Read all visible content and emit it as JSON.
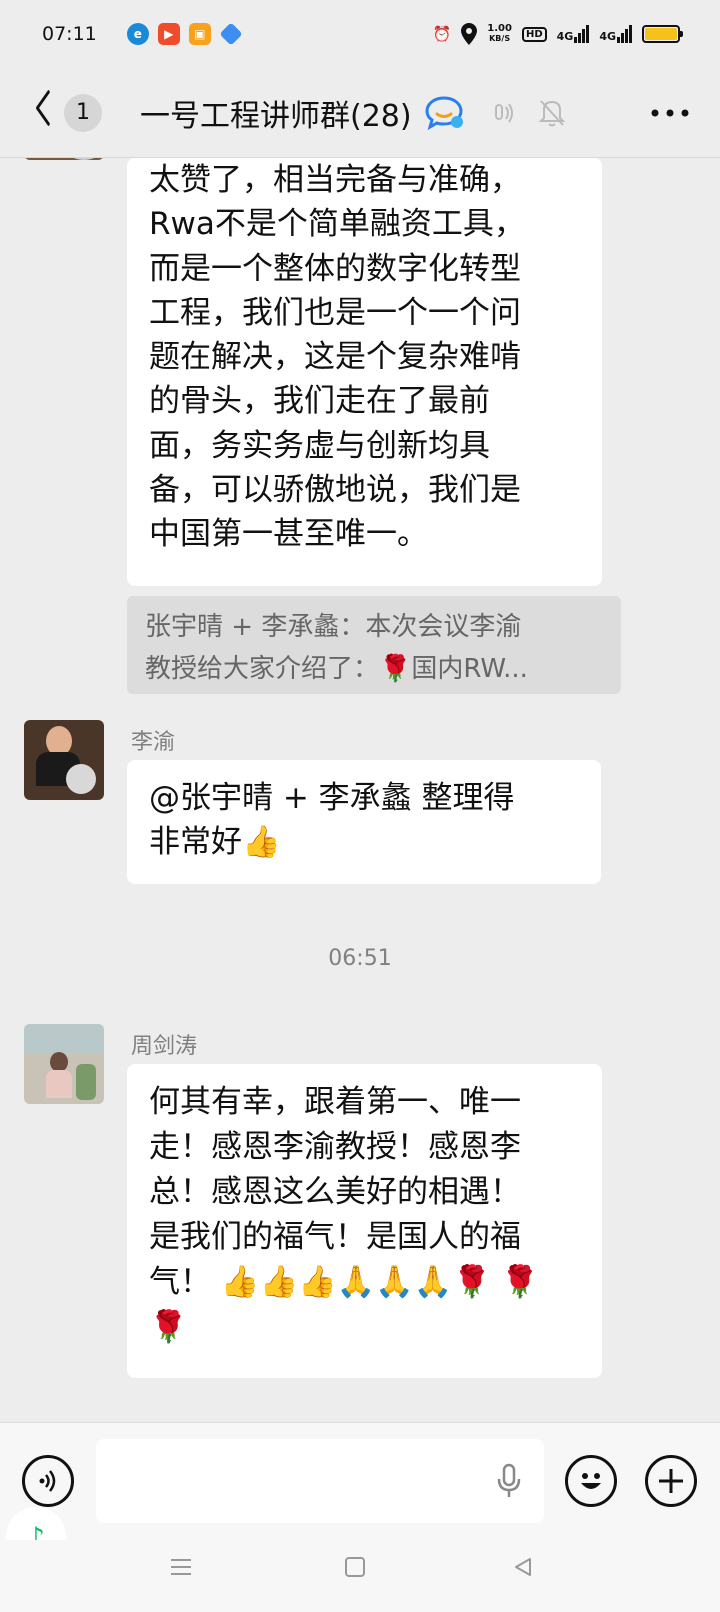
{
  "status_bar": {
    "time": "07:11",
    "net_speed_value": "1.00",
    "net_speed_unit": "KB/S",
    "hd": "HD",
    "signal1": "4G",
    "signal2": "4G"
  },
  "header": {
    "back_count": "1",
    "title": "一号工程讲师群(28)"
  },
  "messages": [
    {
      "text_lines": [
        "太赞了，相当完备与准确，",
        "Rwa不是个简单融资工具，",
        "而是一个整体的数字化转型",
        "工程，我们也是一个一个问",
        "题在解决，这是个复杂难啃",
        "的骨头，我们走在了最前",
        "面，务实务虚与创新均具",
        "备，可以骄傲地说，我们是",
        "中国第一甚至唯一。"
      ],
      "quote_lines": [
        "张宇晴 + 李承蠡：本次会议李渝",
        "教授给大家介绍了：🌹国内RW..."
      ]
    },
    {
      "sender": "李渝",
      "text_lines": [
        "@张宇晴 + 李承蠡  整理得",
        "非常好👍"
      ]
    },
    {
      "timestamp": "06:51"
    },
    {
      "sender": "周剑涛",
      "text_lines": [
        "何其有幸，跟着第一、唯一",
        "走！感恩李渝教授！感恩李",
        "总！感恩这么美好的相遇！",
        "是我们的福气！是国人的福",
        "气！ 👍👍👍🙏🙏🙏🌹 🌹",
        "🌹"
      ]
    }
  ],
  "icons": {
    "back": "chevron-left-icon",
    "voice_mode": "voice-icon",
    "emoji": "emoji-icon",
    "plus": "plus-icon",
    "mic": "mic-icon"
  }
}
